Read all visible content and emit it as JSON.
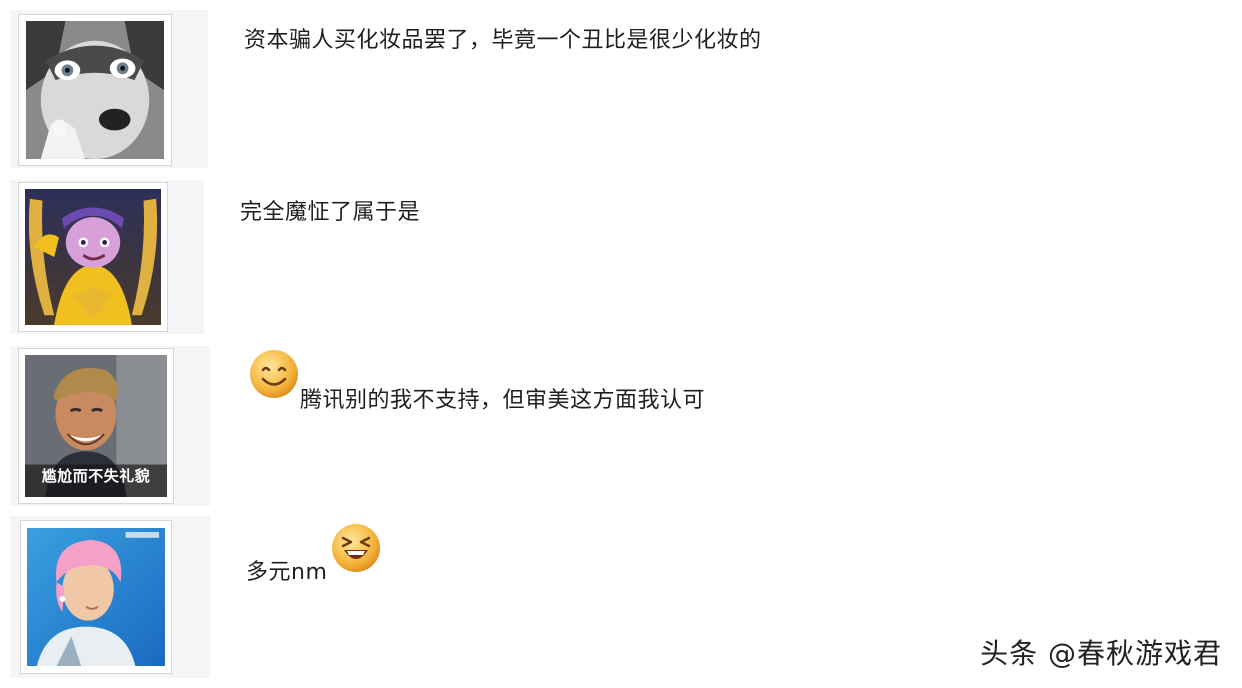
{
  "comments": [
    {
      "text": "资本骗人买化妆品罢了，毕竟一个丑比是很少化妆的",
      "avatar": "husky-icon"
    },
    {
      "text": "完全魔怔了属于是",
      "avatar": "game-hero-icon"
    },
    {
      "text": "腾讯别的我不支持，但审美这方面我认可",
      "avatar": "smiling-man-icon",
      "avatar_caption": "尴尬而不失礼貌",
      "emoji": "smile-emoji-icon"
    },
    {
      "text": "多元nm",
      "avatar": "pink-hair-person-icon",
      "emoji": "laughing-emoji-icon"
    }
  ],
  "watermark": "头条 @春秋游戏君"
}
